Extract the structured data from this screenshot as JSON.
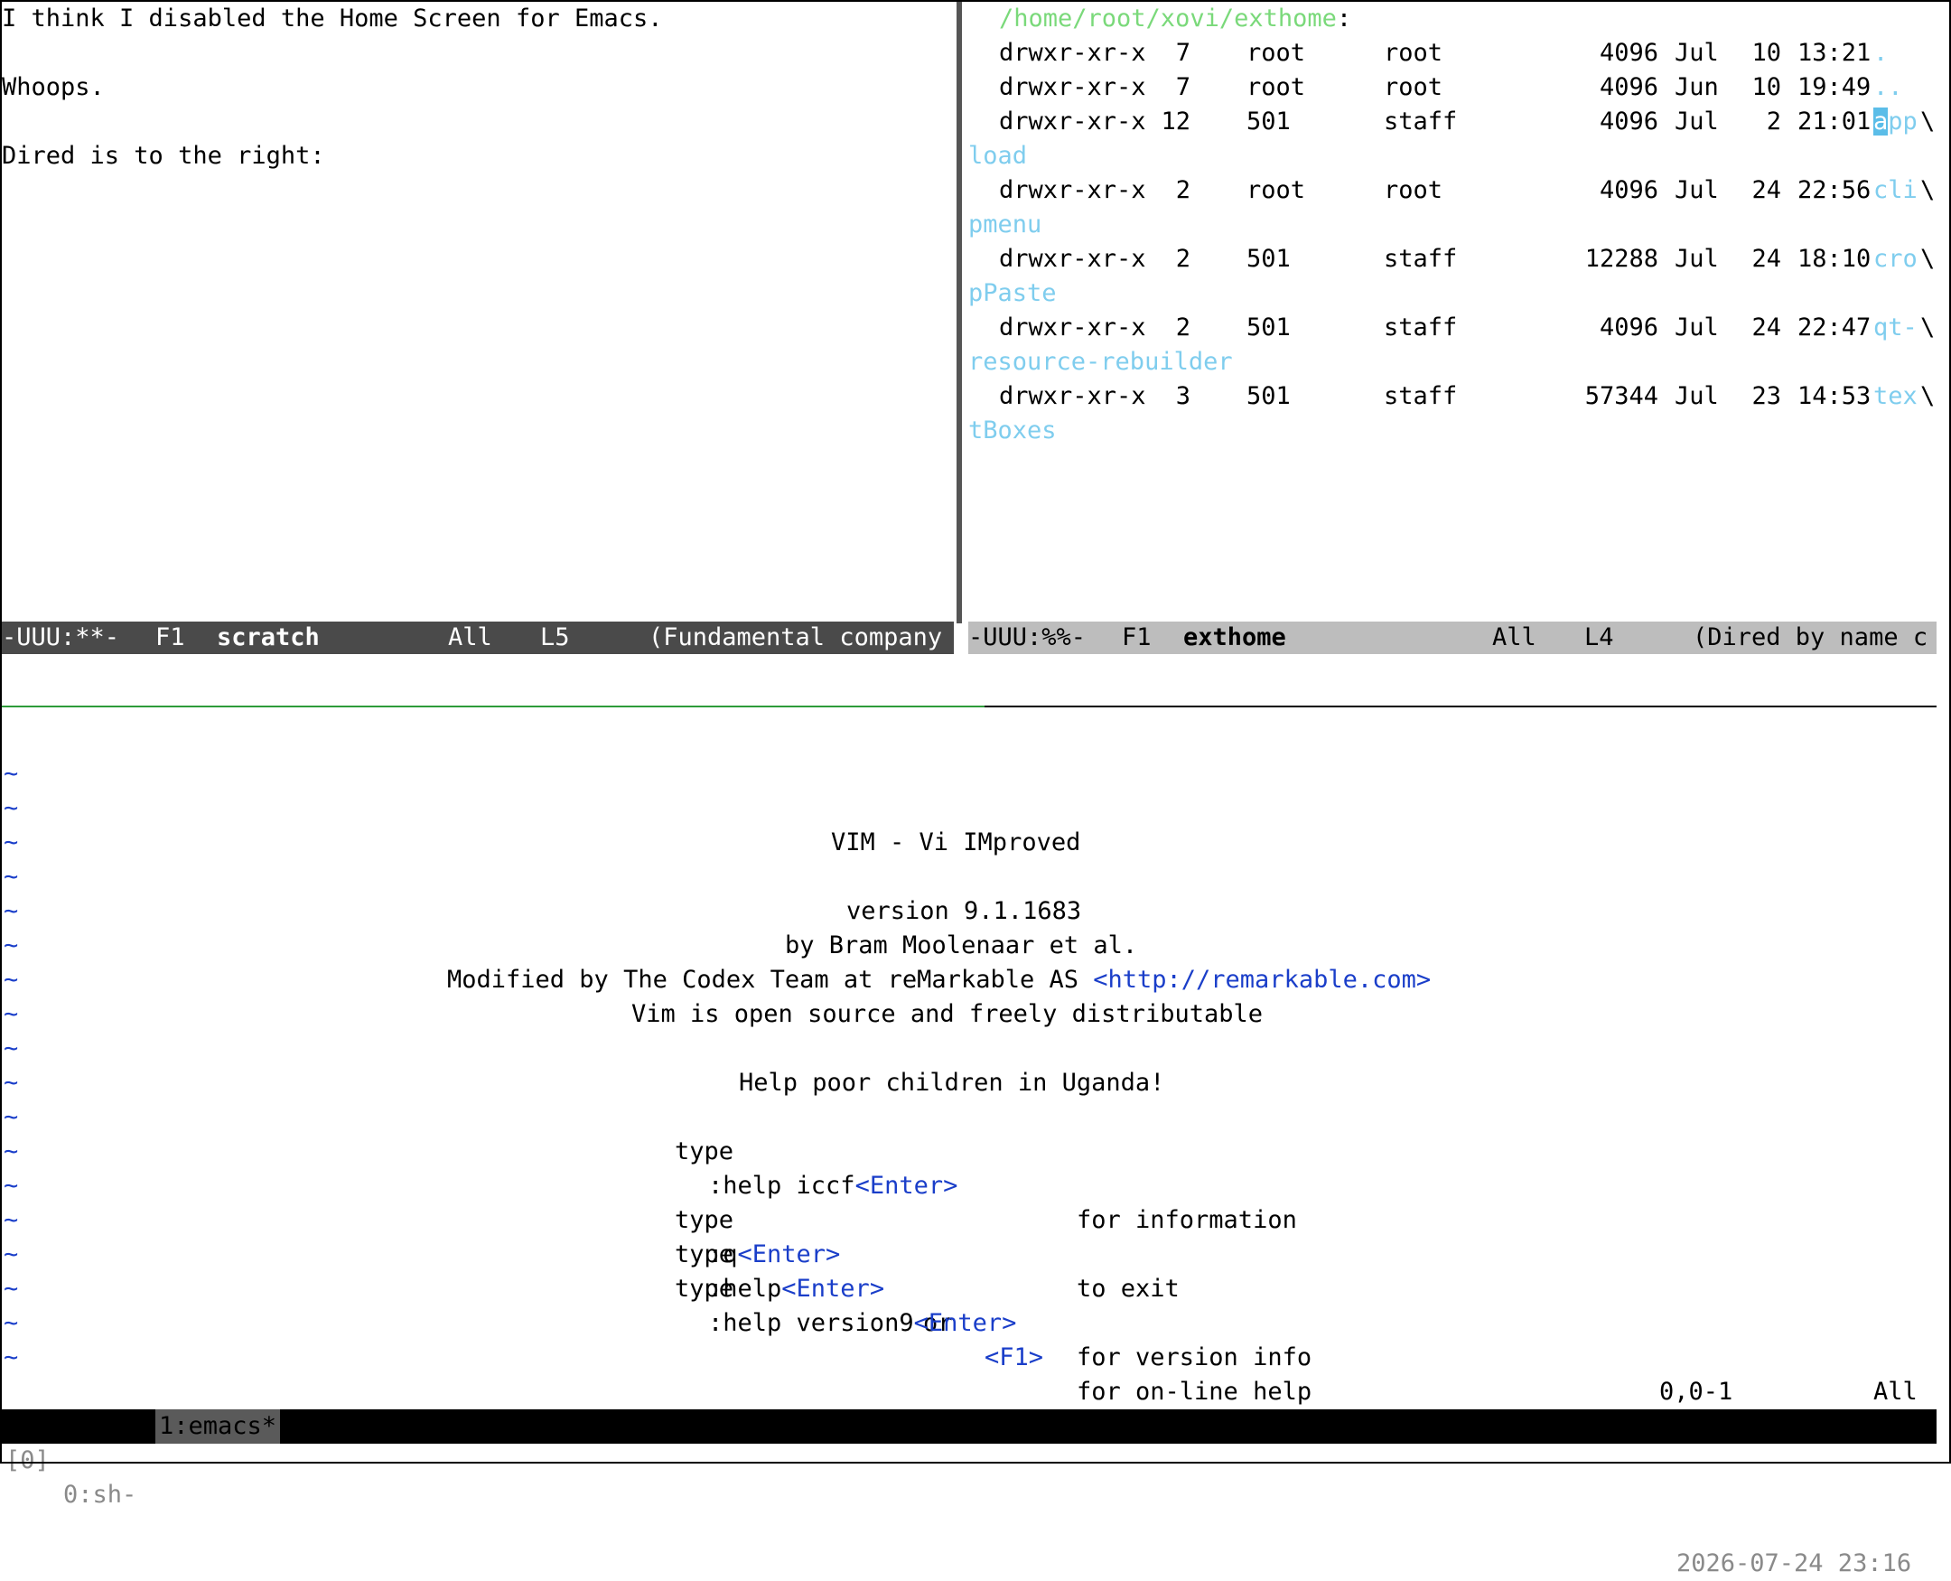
{
  "emacs_left": {
    "lines": [
      "I think I disabled the Home Screen for Emacs.",
      "",
      "Whoops.",
      "",
      "Dired is to the right:"
    ],
    "modeline": {
      "status": "-UUU:**-",
      "frame": "F1",
      "buffer": "scratch",
      "position": "All",
      "line": "L5",
      "mode": "(Fundamental company"
    }
  },
  "dired": {
    "path": "/home/root/xovi/exthome",
    "path_suffix": ":",
    "entries": [
      {
        "perms": "drwxr-xr-x",
        "links": "7",
        "owner": "root",
        "group": "root",
        "size": "4096",
        "month": "Jul",
        "day": "10",
        "time": "13:21",
        "name": ".",
        "wrap": ""
      },
      {
        "perms": "drwxr-xr-x",
        "links": "7",
        "owner": "root",
        "group": "root",
        "size": "4096",
        "month": "Jun",
        "day": "10",
        "time": "19:49",
        "name": "..",
        "wrap": ""
      },
      {
        "perms": "drwxr-xr-x",
        "links": "12",
        "owner": "501",
        "group": "staff",
        "size": "4096",
        "month": "Jul",
        "day": "2",
        "time": "21:01",
        "name": "app",
        "wrap": "load"
      },
      {
        "perms": "drwxr-xr-x",
        "links": "2",
        "owner": "root",
        "group": "root",
        "size": "4096",
        "month": "Jul",
        "day": "24",
        "time": "22:56",
        "name": "cli",
        "wrap": "pmenu"
      },
      {
        "perms": "drwxr-xr-x",
        "links": "2",
        "owner": "501",
        "group": "staff",
        "size": "12288",
        "month": "Jul",
        "day": "24",
        "time": "18:10",
        "name": "cro",
        "wrap": "pPaste"
      },
      {
        "perms": "drwxr-xr-x",
        "links": "2",
        "owner": "501",
        "group": "staff",
        "size": "4096",
        "month": "Jul",
        "day": "24",
        "time": "22:47",
        "name": "qt-",
        "wrap": "resource-rebuilder"
      },
      {
        "perms": "drwxr-xr-x",
        "links": "3",
        "owner": "501",
        "group": "staff",
        "size": "57344",
        "month": "Jul",
        "day": "23",
        "time": "14:53",
        "name": "tex",
        "wrap": "tBoxes"
      }
    ],
    "continuation_char": "\\",
    "modeline": {
      "status": "-UUU:%%-",
      "frame": "F1",
      "buffer": "exthome",
      "position": "All",
      "line": "L4",
      "mode": "(Dired by name c"
    }
  },
  "vim": {
    "tilde": "~",
    "title": "VIM - Vi IMproved",
    "version": "version 9.1.1683",
    "author": "by Bram Moolenaar et al.",
    "modified_prefix": "Modified by The Codex Team at reMarkable AS ",
    "modified_url": "<http://remarkable.com>",
    "license": "Vim is open source and freely distributable",
    "charity": "Help poor children in Uganda!",
    "help_rows": [
      {
        "type": "type",
        "cmd": ":help iccf",
        "key": "<Enter>",
        "desc": "for information"
      },
      {
        "type": "type",
        "cmd": ":q",
        "key": "<Enter>",
        "desc": "to exit"
      },
      {
        "type": "type",
        "cmd": ":help",
        "key": "<Enter>",
        "or": "or",
        "key2": "<F1>",
        "desc": "for on-line help"
      },
      {
        "type": "type",
        "cmd": ":help version9",
        "key": "<Enter>",
        "desc": "for version info"
      }
    ],
    "ruler_pos": "0,0-1",
    "ruler_scroll": "All"
  },
  "tmux": {
    "session": "[0]",
    "window0": "0:sh-",
    "window1": "1:emacs*",
    "datetime": "2026-07-24 23:16"
  },
  "colors": {
    "dired_path": "#7ad97a",
    "dired_name": "#7fcdee",
    "vim_blue": "#1a3ec9",
    "modeline_left_bg": "#4a4a4a",
    "modeline_right_bg": "#bdbdbd"
  }
}
